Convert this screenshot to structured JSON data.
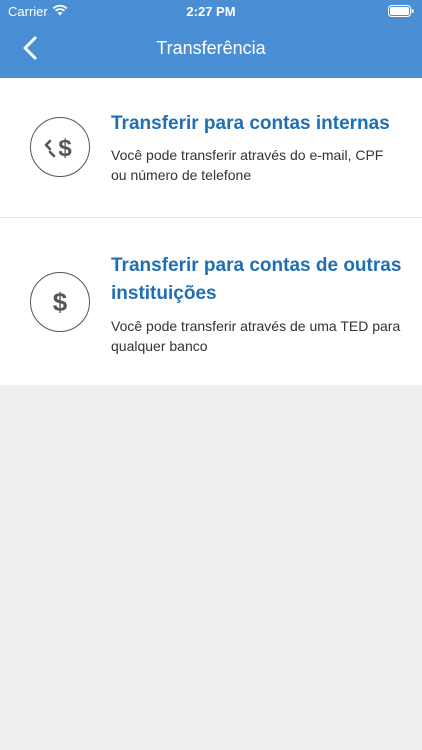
{
  "status_bar": {
    "carrier": "Carrier",
    "time": "2:27 PM",
    "wifi_icon": "wifi-icon",
    "battery_icon": "battery-icon"
  },
  "nav": {
    "title": "Transferência",
    "back_icon": "chevron-left-icon"
  },
  "options": [
    {
      "title": "Transferir para contas internas",
      "description": "Você pode transferir através do e-mail, CPF ou número de telefone",
      "icon": "internal-transfer-icon"
    },
    {
      "title": "Transferir para contas de outras instituições",
      "description": "Você pode transferir através de uma TED para qualquer banco",
      "icon": "dollar-icon"
    }
  ],
  "colors": {
    "header": "#4a8fd6",
    "title_blue": "#1f6fb5",
    "background": "#efefef"
  }
}
